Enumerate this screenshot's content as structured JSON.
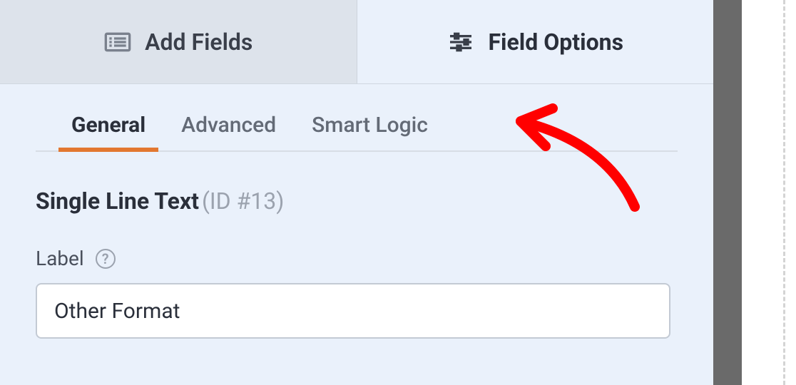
{
  "topTabs": {
    "addFields": "Add Fields",
    "fieldOptions": "Field Options"
  },
  "subTabs": {
    "general": "General",
    "advanced": "Advanced",
    "smartLogic": "Smart Logic"
  },
  "field": {
    "typeName": "Single Line Text",
    "idLabel": "(ID #13)"
  },
  "labelSection": {
    "label": "Label",
    "value": "Other Format"
  },
  "colors": {
    "accent": "#e27730",
    "annotation": "#ff0000"
  }
}
